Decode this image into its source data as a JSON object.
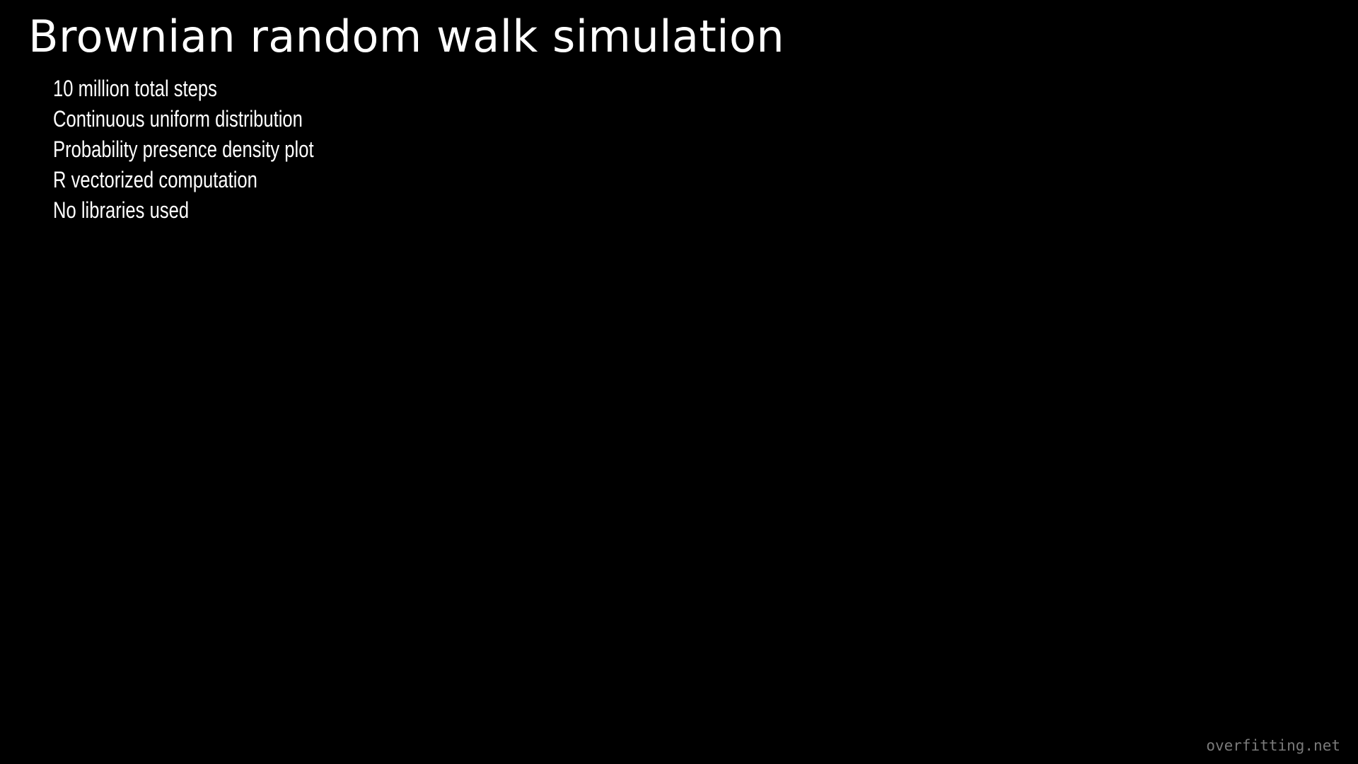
{
  "slide": {
    "title": "Brownian random walk simulation",
    "bullets": [
      "10 million total steps",
      "Continuous uniform distribution",
      "Probability presence density plot",
      "R vectorized computation",
      "No libraries used"
    ],
    "watermark": "overfitting.net"
  },
  "colors": {
    "background": "#000000",
    "text": "#ffffff",
    "watermark": "#7a7a7a"
  }
}
